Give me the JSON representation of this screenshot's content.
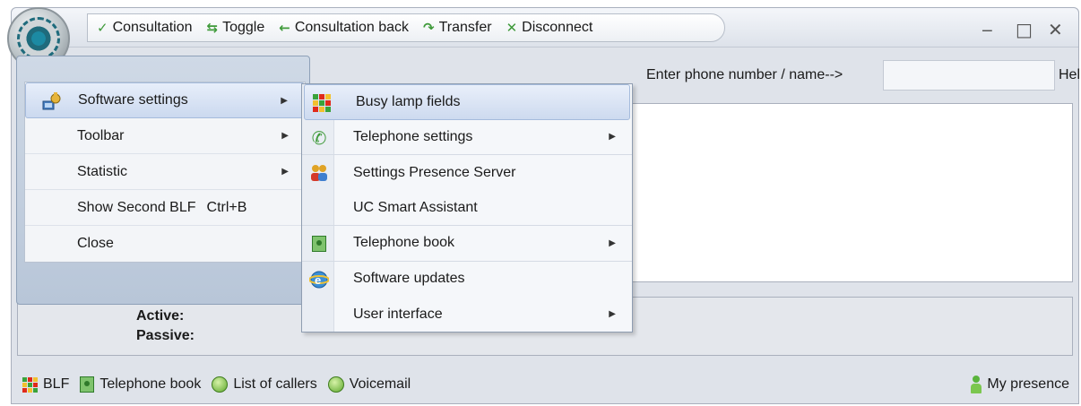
{
  "toolbar": {
    "items": [
      {
        "label": "Consultation",
        "icon": "consultation-icon",
        "glyph": "✓"
      },
      {
        "label": "Toggle",
        "icon": "toggle-icon",
        "glyph": "⇆"
      },
      {
        "label": "Consultation back",
        "icon": "consultation-back-icon",
        "glyph": "←"
      },
      {
        "label": "Transfer",
        "icon": "transfer-icon",
        "glyph": "↷"
      },
      {
        "label": "Disconnect",
        "icon": "disconnect-icon",
        "glyph": "✕"
      }
    ]
  },
  "window_controls": {
    "minimize": "‒",
    "maximize": "□",
    "close": "✕"
  },
  "entry": {
    "label": "Enter phone number / name-->",
    "value": "",
    "help": "Help"
  },
  "menu": {
    "items": [
      {
        "label": "Software settings",
        "arrow": "▶",
        "highlighted": true
      },
      {
        "label": "Toolbar",
        "arrow": "▶"
      },
      {
        "label": "Statistic",
        "arrow": "▶"
      },
      {
        "label": "Show Second BLF",
        "shortcut": "Ctrl+B"
      },
      {
        "label": "Close"
      }
    ]
  },
  "submenu": {
    "items": [
      {
        "label": "Busy lamp fields",
        "icon": "busy-lamp-fields-icon",
        "highlighted": true
      },
      {
        "label": "Telephone settings",
        "icon": "telephone-icon",
        "arrow": "▶"
      },
      {
        "label": "Settings Presence Server",
        "icon": "presence-server-icon"
      },
      {
        "label": "UC Smart Assistant",
        "icon": ""
      },
      {
        "label": "Telephone book",
        "icon": "telephone-book-icon",
        "arrow": "▶"
      },
      {
        "label": "Software updates",
        "icon": "software-updates-icon"
      },
      {
        "label": "User interface",
        "icon": "",
        "arrow": "▶"
      }
    ]
  },
  "status": {
    "active": "Active:",
    "passive": "Passive:"
  },
  "bottombar": {
    "blf": "BLF",
    "telephone_book": "Telephone book",
    "list_of_callers": "List of callers",
    "voicemail": "Voicemail",
    "my_presence": "My presence"
  },
  "colors": {
    "accent_green": "#3f9a3a",
    "blf_red": "#e02a1a",
    "blf_yellow": "#f2c12e",
    "blf_green": "#3aa33a"
  }
}
